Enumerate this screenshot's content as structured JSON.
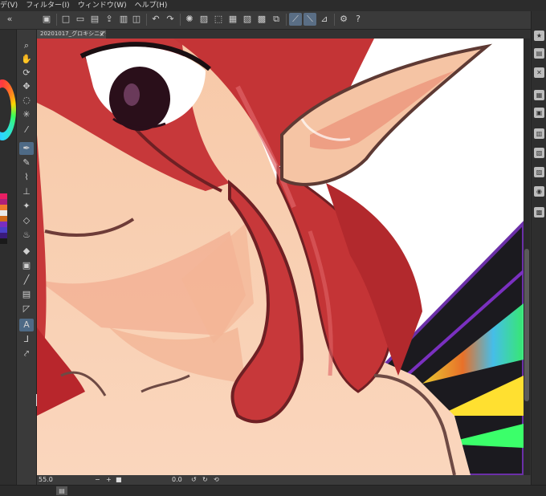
{
  "menu": {
    "items": [
      "デ(V)",
      "フィルター(I)",
      "ウィンドウ(W)",
      "ヘルプ(H)"
    ]
  },
  "document": {
    "tab_title": "20201017_グロキシニア*",
    "close_glyph": "×"
  },
  "status": {
    "zoom": "55.0",
    "angle": "0.0"
  },
  "colors": {
    "accent": "#5a6e85",
    "skin": "#f7c9a8",
    "hair": "#c7383a",
    "hair_dark": "#8e1c22"
  },
  "icons": {
    "toolbar": [
      "new-file-icon",
      "open-folder-icon",
      "save-icon",
      "undo-icon",
      "redo-icon",
      "transform-icon",
      "snap-icon",
      "settings-icon",
      "help-icon"
    ],
    "tools": [
      "zoom-icon",
      "hand-icon",
      "rotate-icon",
      "move-icon",
      "lasso-icon",
      "magic-wand-icon",
      "eyedropper-icon",
      "pen-icon",
      "pencil-icon",
      "brush-icon",
      "airbrush-icon",
      "decoration-icon",
      "eraser-icon",
      "blend-icon",
      "fill-icon",
      "gradient-icon",
      "figure-icon",
      "frame-icon",
      "ruler-icon",
      "text-icon",
      "balloon-icon",
      "line-correction-icon"
    ]
  }
}
